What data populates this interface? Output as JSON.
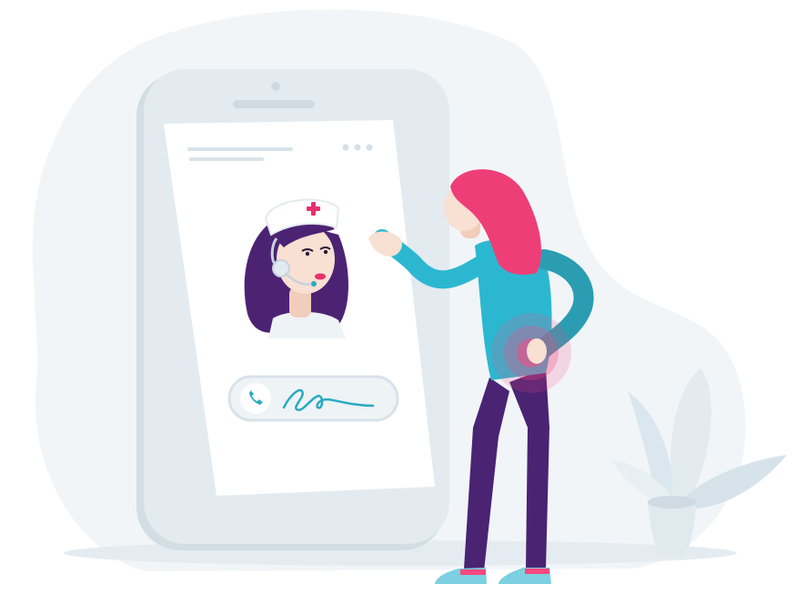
{
  "illustration": {
    "subject": "telehealth-video-call",
    "phone_screen": {
      "header_menu_icon": "more-dots-icon",
      "caller_avatar": "nurse-with-headset",
      "call_bar": {
        "call_icon": "phone-icon",
        "signature_visible": true
      }
    },
    "patient": {
      "pain_indicator": "lower-back"
    },
    "decor": {
      "plant": "potted-plant"
    }
  },
  "colors": {
    "blob": "#f1f5f8",
    "phone_frame": "#e3ebf0",
    "phone_shadow": "#d3dde4",
    "screen": "#ffffff",
    "nurse_hair": "#4c2373",
    "nurse_cap_cross": "#e8306e",
    "skin": "#f8e0d2",
    "patient_hair": "#ee3e77",
    "patient_top": "#2cb7d1",
    "patient_leggings": "#4a2373",
    "pain_glow": "#f7487f",
    "call_accent": "#2aaac2",
    "plant_leaf": "#dbe7ee"
  }
}
